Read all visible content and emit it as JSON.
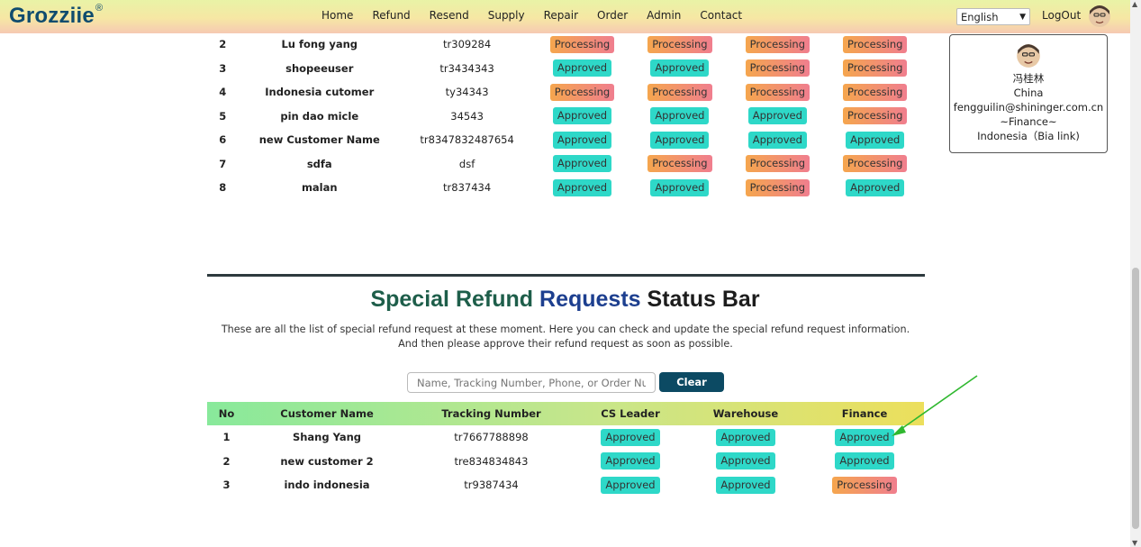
{
  "brand": {
    "name": "Grozziie",
    "mark": "®"
  },
  "nav": {
    "links": [
      "Home",
      "Refund",
      "Resend",
      "Supply",
      "Repair",
      "Order",
      "Admin",
      "Contact"
    ],
    "language": "English",
    "logout": "LogOut"
  },
  "profile": {
    "name": "冯桂林",
    "country": "China",
    "email": "fengguilin@shininger.com.cn",
    "role": "~Finance~",
    "region": "Indonesia（Bia link)"
  },
  "refund_table": {
    "rows": [
      {
        "no": "2",
        "name": "Lu fong yang",
        "tracking": "tr309284",
        "s1": "Processing",
        "s2": "Processing",
        "s3": "Processing",
        "s4": "Processing"
      },
      {
        "no": "3",
        "name": "shopeeuser",
        "tracking": "tr3434343",
        "s1": "Approved",
        "s2": "Approved",
        "s3": "Processing",
        "s4": "Processing"
      },
      {
        "no": "4",
        "name": "Indonesia cutomer",
        "tracking": "ty34343",
        "s1": "Processing",
        "s2": "Processing",
        "s3": "Processing",
        "s4": "Processing"
      },
      {
        "no": "5",
        "name": "pin dao micle",
        "tracking": "34543",
        "s1": "Approved",
        "s2": "Approved",
        "s3": "Approved",
        "s4": "Processing"
      },
      {
        "no": "6",
        "name": "new Customer Name",
        "tracking": "tr8347832487654",
        "s1": "Approved",
        "s2": "Approved",
        "s3": "Approved",
        "s4": "Approved"
      },
      {
        "no": "7",
        "name": "sdfa",
        "tracking": "dsf",
        "s1": "Approved",
        "s2": "Processing",
        "s3": "Processing",
        "s4": "Processing"
      },
      {
        "no": "8",
        "name": "malan",
        "tracking": "tr837434",
        "s1": "Approved",
        "s2": "Approved",
        "s3": "Processing",
        "s4": "Approved"
      }
    ]
  },
  "special": {
    "title_part1": "Special",
    "title_part2": "Refund",
    "title_part3": "Requests",
    "title_part4": "Status Bar",
    "description": "These are all the list of special refund request at these moment. Here you can check and update the special refund request information. And then please approve their refund request as soon as possible.",
    "search_placeholder": "Name, Tracking Number, Phone, or Order Number",
    "clear_label": "Clear",
    "headers": {
      "no": "No",
      "name": "Customer Name",
      "tracking": "Tracking Number",
      "cs": "CS Leader",
      "warehouse": "Warehouse",
      "finance": "Finance"
    },
    "rows": [
      {
        "no": "1",
        "name": "Shang Yang",
        "tracking": "tr7667788898",
        "cs": "Approved",
        "warehouse": "Approved",
        "finance": "Approved"
      },
      {
        "no": "2",
        "name": "new customer 2",
        "tracking": "tre834834843",
        "cs": "Approved",
        "warehouse": "Approved",
        "finance": "Approved"
      },
      {
        "no": "3",
        "name": "indo indonesia",
        "tracking": "tr9387434",
        "cs": "Approved",
        "warehouse": "Approved",
        "finance": "Processing"
      }
    ]
  },
  "colors": {
    "approved": "#2ed8c8",
    "processing_from": "#f5a64e",
    "processing_to": "#f07e8e",
    "brand": "#0f4c6e",
    "arrow": "#2fb82f"
  }
}
